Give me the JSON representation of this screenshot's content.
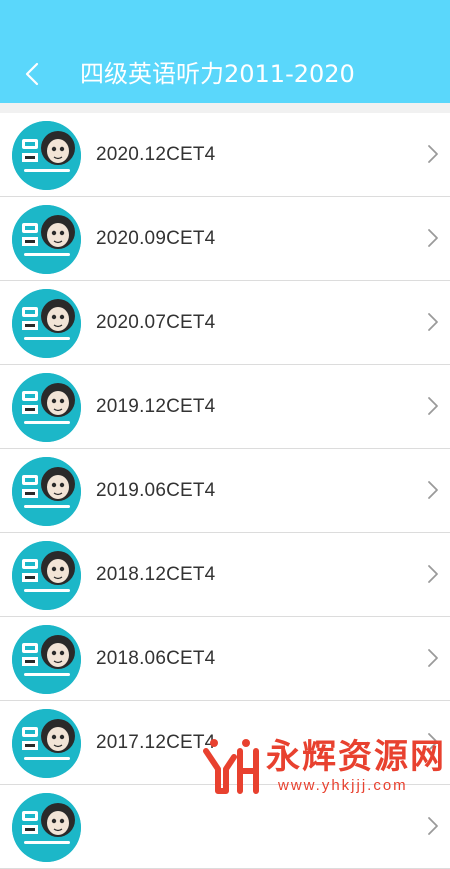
{
  "header": {
    "title": "四级英语听力2011-2020",
    "back_icon": "chevron-left-icon",
    "background": "#5ad7fb"
  },
  "list": {
    "items": [
      {
        "label": "2020.12CET4",
        "thumb_icon": "cet-avatar-icon"
      },
      {
        "label": "2020.09CET4",
        "thumb_icon": "cet-avatar-icon"
      },
      {
        "label": "2020.07CET4",
        "thumb_icon": "cet-avatar-icon"
      },
      {
        "label": "2019.12CET4",
        "thumb_icon": "cet-avatar-icon"
      },
      {
        "label": "2019.06CET4",
        "thumb_icon": "cet-avatar-icon"
      },
      {
        "label": "2018.12CET4",
        "thumb_icon": "cet-avatar-icon"
      },
      {
        "label": "2018.06CET4",
        "thumb_icon": "cet-avatar-icon"
      },
      {
        "label": "2017.12CET4",
        "thumb_icon": "cet-avatar-icon"
      },
      {
        "label": "",
        "thumb_icon": "cet-avatar-icon"
      }
    ],
    "chevron_icon": "chevron-right-icon"
  },
  "watermark": {
    "title": "永辉资源网",
    "url": "www.yhkjjj.com",
    "color": "#e8412f"
  }
}
